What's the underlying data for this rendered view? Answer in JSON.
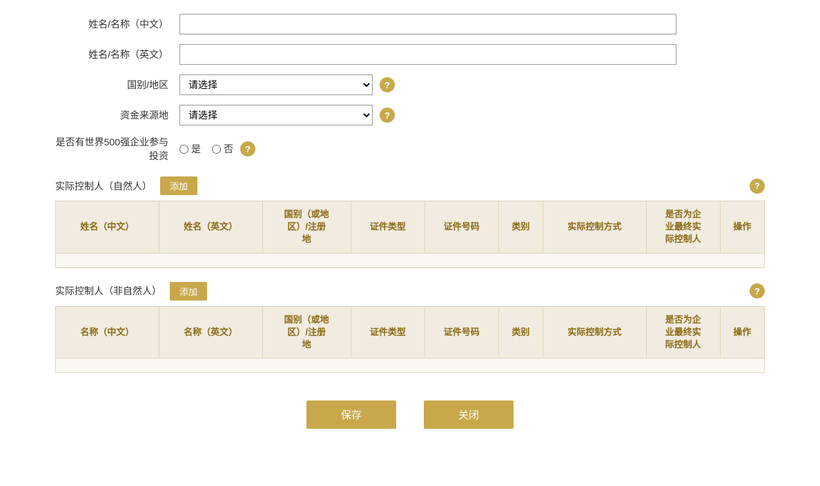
{
  "form": {
    "name_cn_label": "姓名/名称（中文）",
    "name_en_label": "姓名/名称（英文）",
    "country_label": "国别/地区",
    "fund_source_label": "资金来源地",
    "fortune500_label": "是否有世界500强企业参与投资",
    "country_placeholder": "请选择",
    "fund_source_placeholder": "请选择",
    "radio_yes": "是",
    "radio_no": "否",
    "name_cn_value": "",
    "name_en_value": ""
  },
  "controller_natural": {
    "section_label": "实际控制人（自然人）",
    "add_btn_label": "添加",
    "columns": [
      "姓名（中文）",
      "姓名（英文）",
      "国别（或地区）/注册地",
      "证件类型",
      "证件号码",
      "类别",
      "实际控制方式",
      "是否为企业最终实际控制人",
      "操作"
    ]
  },
  "controller_non_natural": {
    "section_label": "实际控制人（非自然人）",
    "add_btn_label": "添加",
    "columns": [
      "名称（中文）",
      "名称（英文）",
      "国别（或地区）/注册地",
      "证件类型",
      "证件号码",
      "类别",
      "实际控制方式",
      "是否为企业最终实际控制人",
      "操作"
    ]
  },
  "buttons": {
    "save": "保存",
    "close": "关闭"
  },
  "icons": {
    "help": "?",
    "dropdown": "▼"
  }
}
